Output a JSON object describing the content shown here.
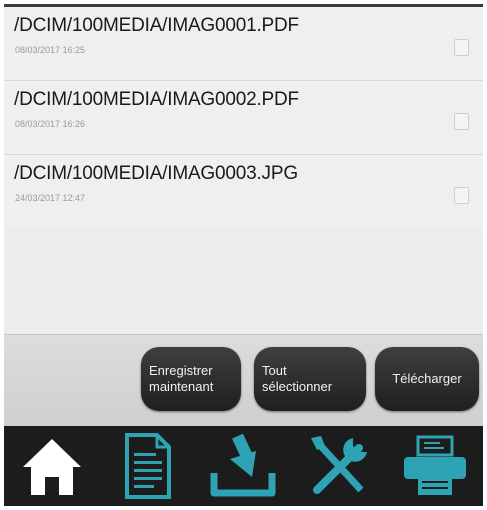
{
  "files": [
    {
      "path": "/DCIM/100MEDIA/IMAG0001.PDF",
      "date": "08/03/2017 16:25"
    },
    {
      "path": "/DCIM/100MEDIA/IMAG0002.PDF",
      "date": "08/03/2017 16:26"
    },
    {
      "path": "/DCIM/100MEDIA/IMAG0003.JPG",
      "date": "24/03/2017 12:47"
    }
  ],
  "actions": {
    "save_line1": "Enregistrer",
    "save_line2": "maintenant",
    "select_line1": "Tout",
    "select_line2": "sélectionner",
    "download": "Télécharger"
  },
  "nav": {
    "items": [
      "home-icon",
      "document-icon",
      "download-tray-icon",
      "tools-icon",
      "printer-icon"
    ]
  },
  "colors": {
    "accent": "#2ea3b3",
    "nav_background": "#1c1c1c",
    "button_background": "#2b2b2b"
  }
}
